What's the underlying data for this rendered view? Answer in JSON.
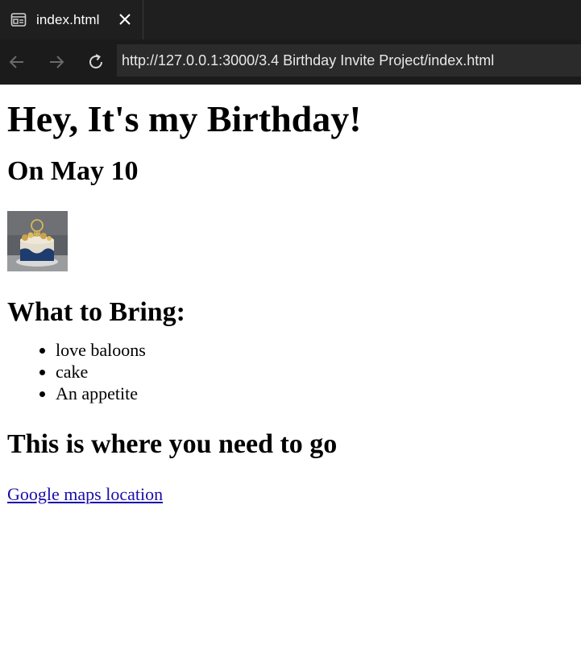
{
  "browser": {
    "tab_title": "index.html",
    "url": "http://127.0.0.1:3000/3.4 Birthday Invite Project/index.html"
  },
  "page": {
    "heading": "Hey, It's my Birthday!",
    "date": "On May 10",
    "bring_heading": "What to Bring:",
    "bring_items": [
      "love baloons",
      "cake",
      "An appetite"
    ],
    "go_heading": "This is where you need to go",
    "map_link": "Google maps location"
  },
  "colors": {
    "tabbar_bg": "#1f1f1f",
    "toolbar_bg": "#1b1b1b",
    "url_bg": "#2b2b2b",
    "link": "#1a0dab"
  }
}
